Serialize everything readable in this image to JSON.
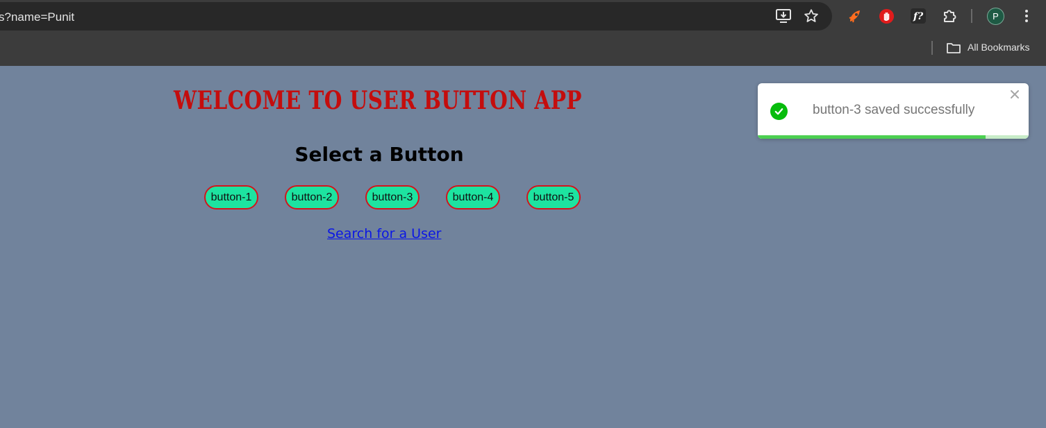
{
  "browser": {
    "url": "s?name=Punit",
    "bookmarks_label": "All Bookmarks",
    "profile_initial": "P",
    "profile_color": "#1e5a44",
    "icons": [
      "install-app-icon",
      "star-icon",
      "extension-rocket-icon",
      "adblock-hand-icon",
      "font-detect-icon",
      "puzzle-extensions-icon",
      "avatar",
      "kebab-menu-icon",
      "folder-icon"
    ]
  },
  "page": {
    "title": "WELCOME TO USER BUTTON APP",
    "subtitle": "Select a Button",
    "buttons": [
      {
        "label": "button-1"
      },
      {
        "label": "button-2"
      },
      {
        "label": "button-3"
      },
      {
        "label": "button-4"
      },
      {
        "label": "button-5"
      }
    ],
    "search_link": "Search for a User",
    "colors": {
      "background": "#71839c",
      "title": "#c40d0d",
      "button_fill": "#1de3a0",
      "button_border": "#d3141c",
      "link": "#0a16e6"
    }
  },
  "toast": {
    "message": "button-3 saved successfully",
    "type": "success",
    "progress": 0.84,
    "colors": {
      "icon": "#07bc0c",
      "progress": "#4cd051"
    }
  }
}
